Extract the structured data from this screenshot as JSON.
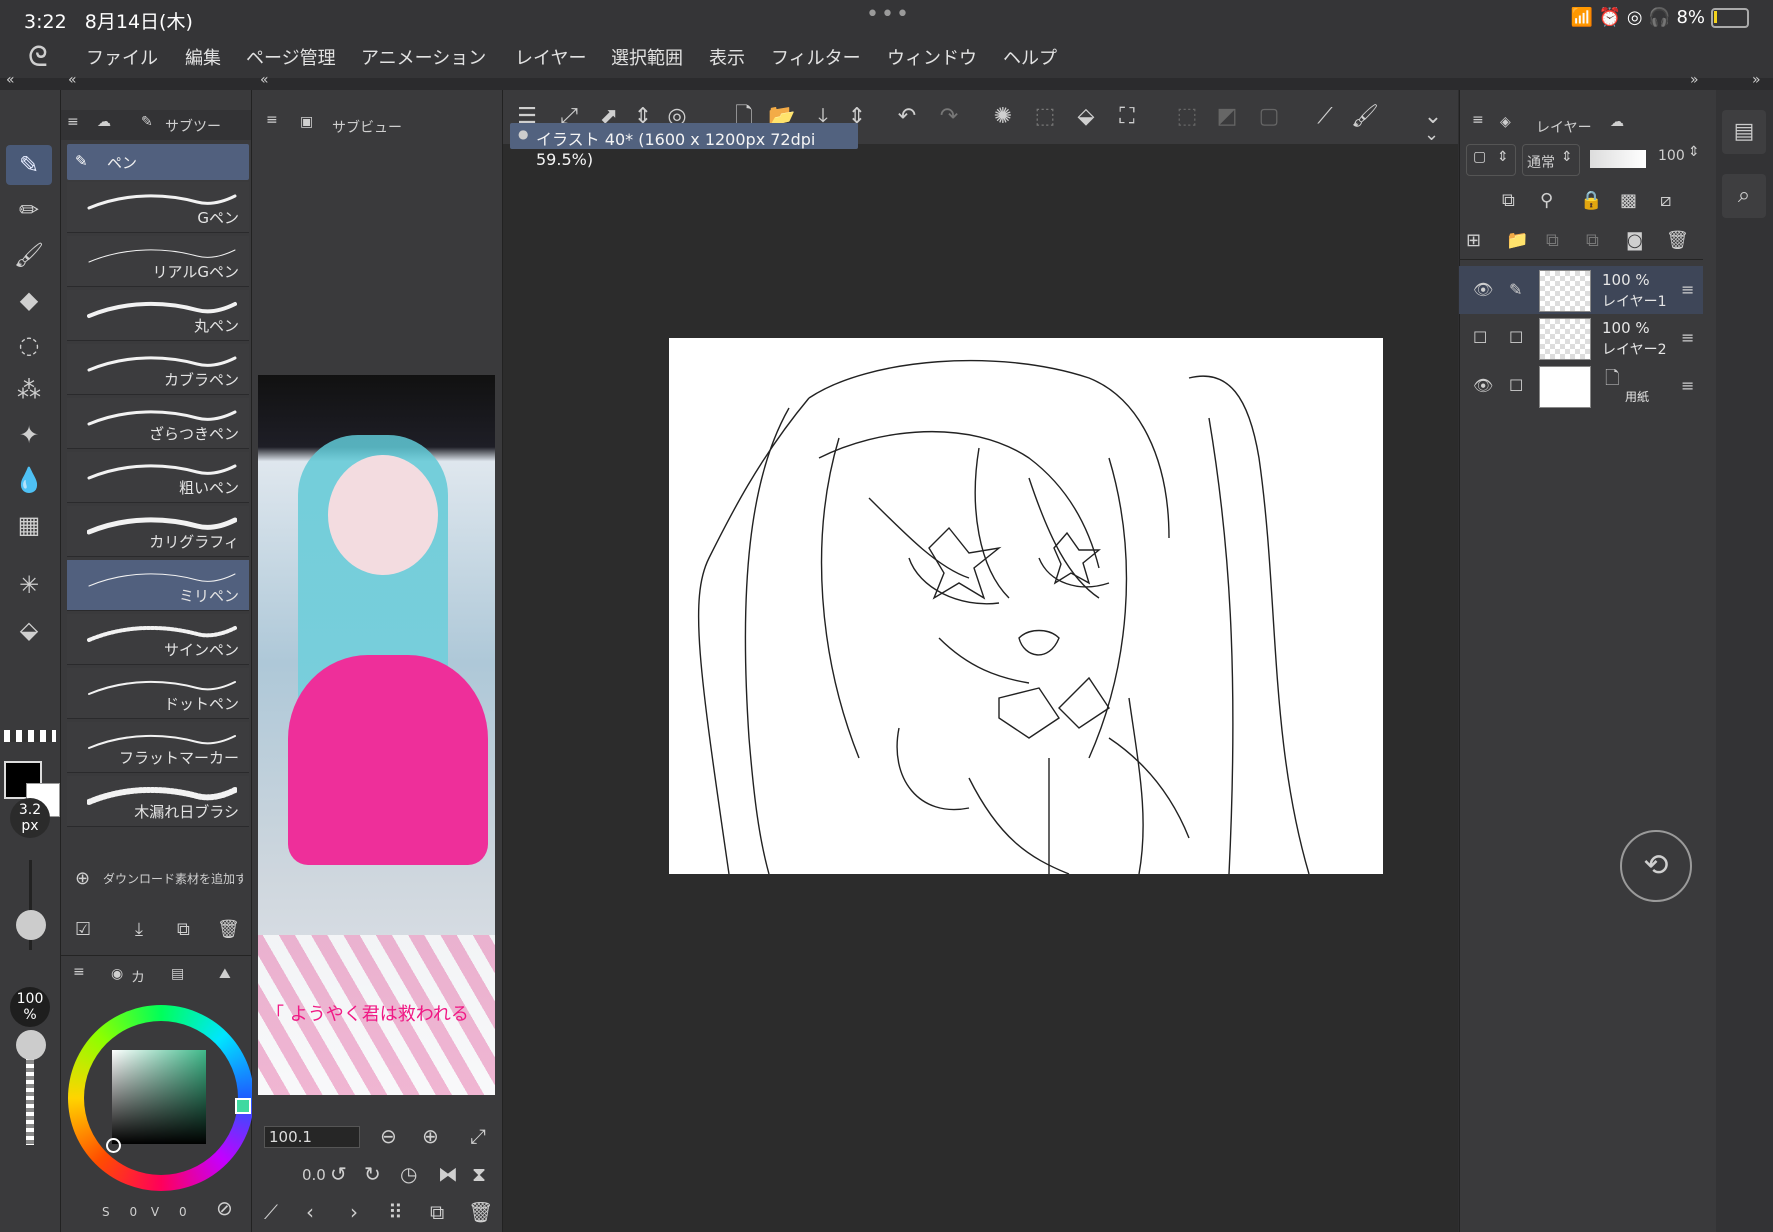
{
  "status": {
    "time": "3:22",
    "date": "8月14日(木)",
    "battery": "8%"
  },
  "menu": [
    "ファイル",
    "編集",
    "ページ管理",
    "アニメーション",
    "レイヤー",
    "選択範囲",
    "表示",
    "フィルター",
    "ウィンドウ",
    "ヘルプ"
  ],
  "subtool_panel": {
    "tab_label": "サブツー",
    "group_label": "ペン",
    "brushes": [
      "Gペン",
      "リアルGペン",
      "丸ペン",
      "カブラペン",
      "ざらつきペン",
      "粗いペン",
      "カリグラフィ",
      "ミリペン",
      "サインペン",
      "ドットペン",
      "フラットマーカー",
      "木漏れ日ブラシ"
    ],
    "active_brush": "ミリペン",
    "download_label": "ダウンロード素材を追加す"
  },
  "subview_panel": {
    "tab_label": "サブビュー",
    "zoom": "100.1",
    "rotation": "0.0",
    "caption": "「 ようやく君は救われる"
  },
  "document_tab": "イラスト 40* (1600 x 1200px 72dpi 59.5%)",
  "brush_size": {
    "value": "3.2",
    "unit": "px"
  },
  "opacity": {
    "value": "100",
    "unit": "%"
  },
  "color_panel": {
    "tab_label": "カ",
    "s_label": "S",
    "s_value": "0",
    "v_label": "V",
    "v_value": "0"
  },
  "layer_panel": {
    "tab_label": "レイヤー",
    "blend_mode": "通常",
    "opacity": "100",
    "layers": [
      {
        "opacity": "100 %",
        "name": "レイヤー1",
        "visible": true,
        "active": true
      },
      {
        "opacity": "100 %",
        "name": "レイヤー2",
        "visible": false,
        "active": false
      },
      {
        "opacity": "",
        "name": "用紙",
        "visible": true,
        "active": false
      }
    ]
  },
  "colors": {
    "accent": "#51607e",
    "panel": "#3a3a3c",
    "canvas_bg": "#2c2c2c"
  }
}
